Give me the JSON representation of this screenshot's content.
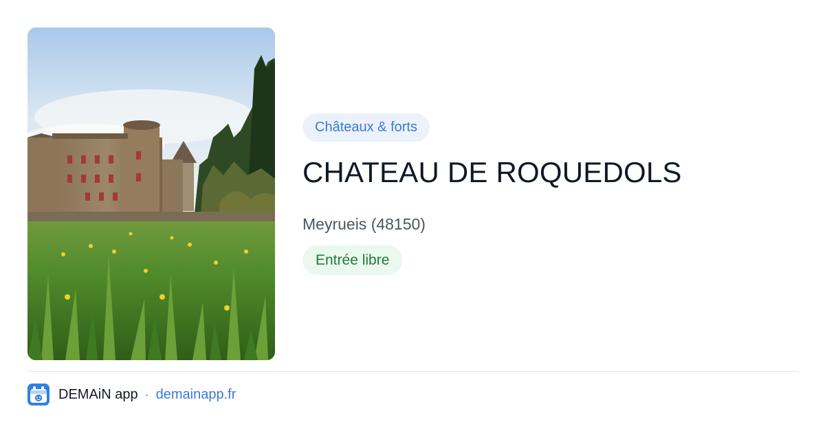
{
  "card": {
    "category": "Châteaux & forts",
    "title": "CHATEAU DE ROQUEDOLS",
    "location": "Meyrueis (48150)",
    "access": "Entrée libre"
  },
  "photo": {
    "subject": "chateau-photo"
  },
  "footer": {
    "app_name": "DEMAiN app",
    "separator": "·",
    "url": "demainapp.fr"
  },
  "colors": {
    "category_text": "#3a7bd5",
    "category_bg": "#ebf2fc",
    "access_text": "#1f7a3c",
    "access_bg": "#ebf8ee",
    "title": "#101828",
    "link": "#3a7bd5"
  },
  "icons": {
    "app": "demain-app-icon"
  }
}
